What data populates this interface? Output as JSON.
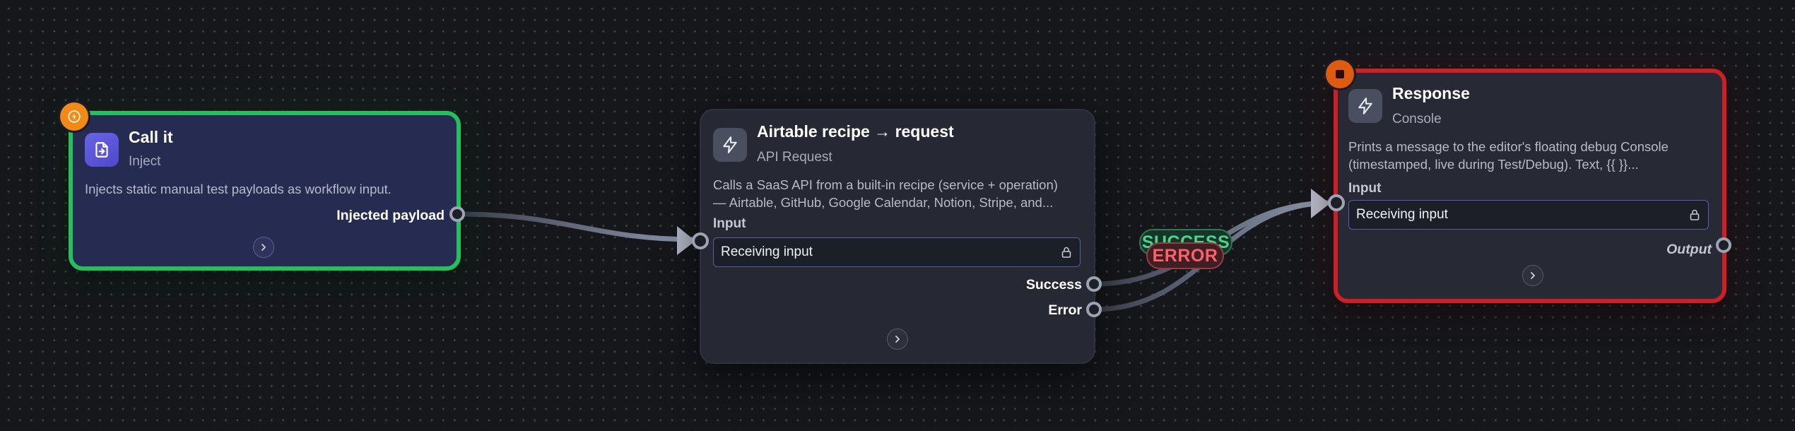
{
  "nodes": {
    "inject": {
      "title": "Call it",
      "subtitle": "Inject",
      "description": "Injects static manual test payloads as workflow input.",
      "output_label": "Injected payload",
      "border_color": "#23c15d",
      "icon": "file-import-icon",
      "badge_icon": "lightning-icon"
    },
    "api_request": {
      "title": "Airtable recipe → request",
      "subtitle": "API Request",
      "description_line1": "Calls a SaaS API from a built-in recipe (service + operation)",
      "description_line2": "— Airtable, GitHub, Google Calendar, Notion, Stripe, and...",
      "input_label": "Input",
      "input_value": "Receiving input",
      "outputs": [
        "Success",
        "Error"
      ],
      "icon": "lightning-icon"
    },
    "console": {
      "title": "Response",
      "subtitle": "Console",
      "description_line1": "Prints a message to the editor's floating debug Console",
      "description_line2": "(timestamped, live during Test/Debug). Text, {{ }}...",
      "input_label": "Input",
      "input_value": "Receiving input",
      "output_label": "Output",
      "border_color": "#cd2026",
      "icon": "lightning-icon",
      "badge_icon": "stop-icon"
    }
  },
  "edges": {
    "success_label": "SUCCESS",
    "error_label": "ERROR",
    "success_color": "#4fd18c",
    "error_color": "#ff6068"
  },
  "colors": {
    "canvas_bg": "#16171b",
    "wire": "#8a93a8",
    "trigger_badge": "#f08a18",
    "stop_badge": "#de5b12"
  }
}
